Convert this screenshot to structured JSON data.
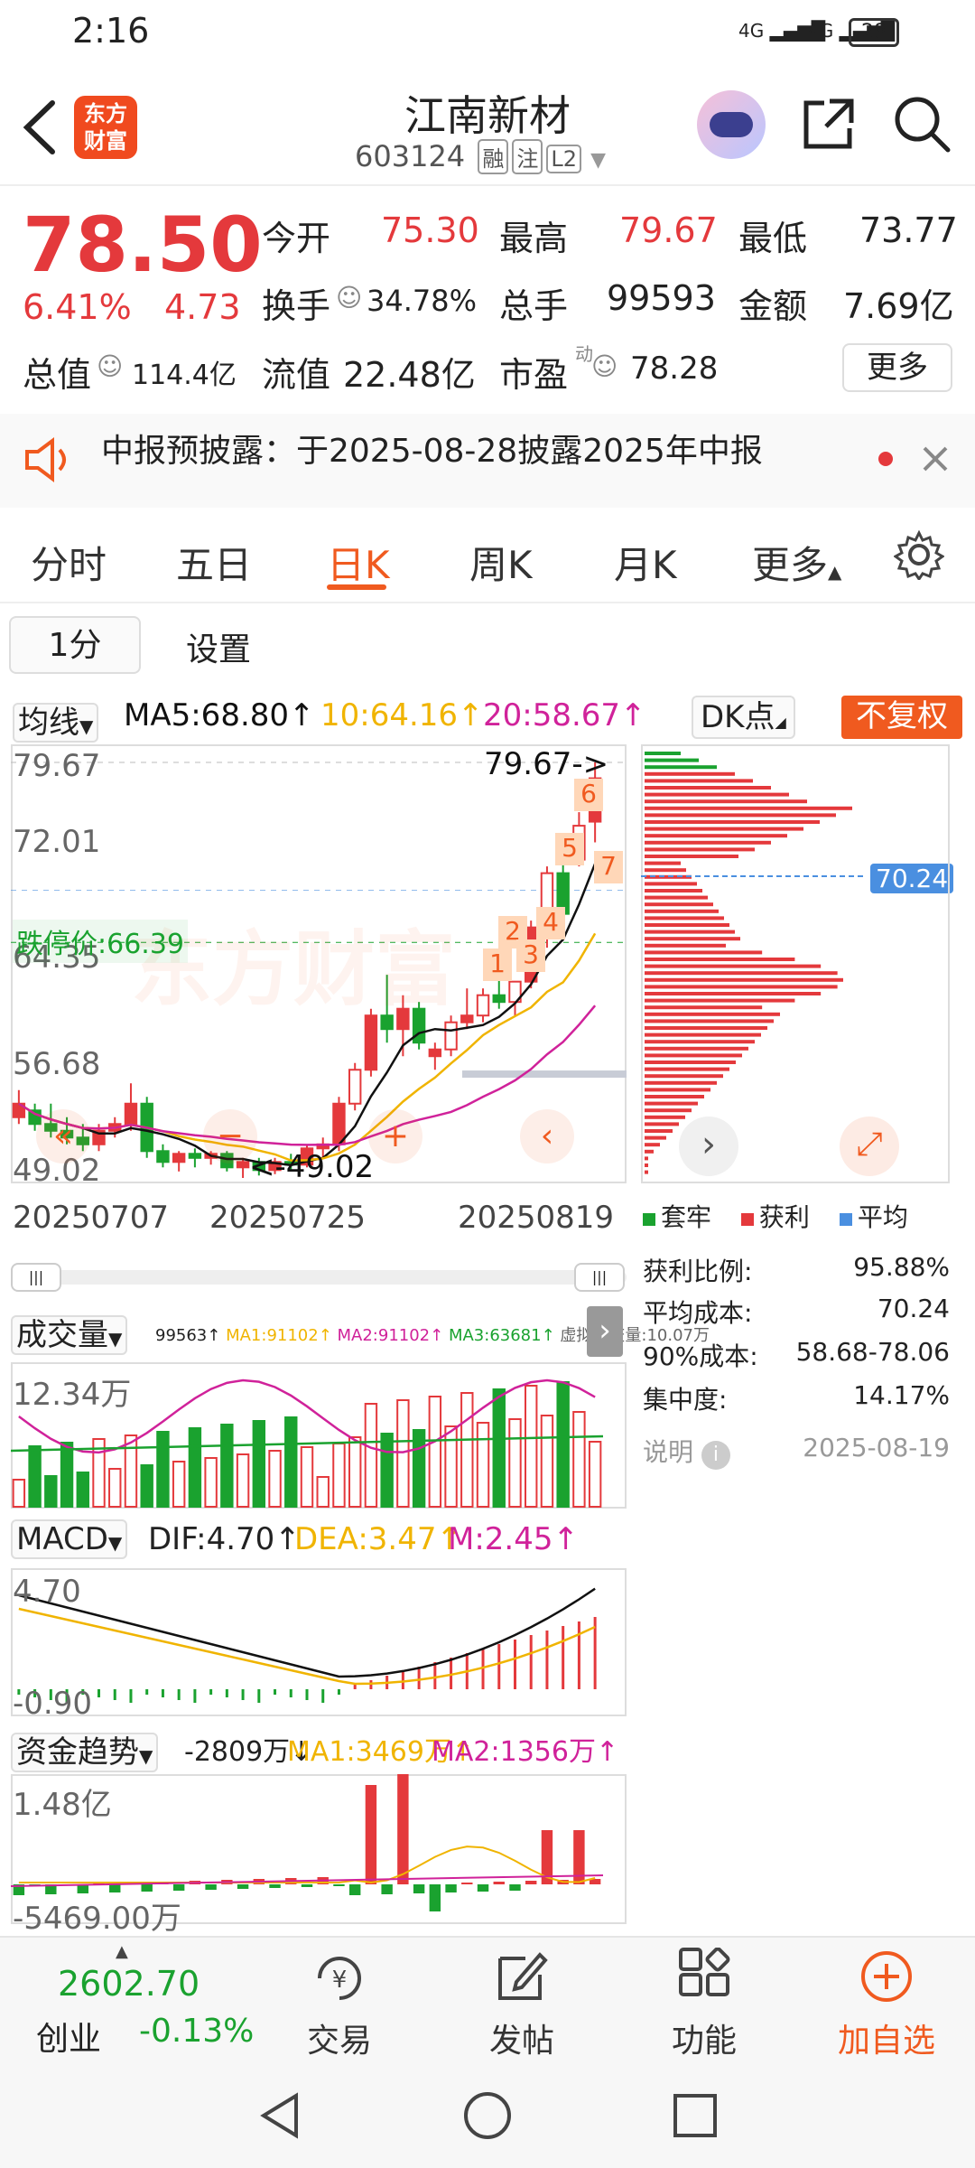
{
  "status": {
    "time": "2:16",
    "battery": "28",
    "net1": "4G",
    "net2": "4G"
  },
  "header": {
    "title": "江南新材",
    "code": "603124",
    "tags": [
      "融",
      "注",
      "L2"
    ],
    "logo_line1": "东方",
    "logo_line2": "财富"
  },
  "quote": {
    "price": "78.50",
    "change_pct": "6.41%",
    "change": "4.73",
    "open_label": "今开",
    "open": "75.30",
    "high_label": "最高",
    "high": "79.67",
    "low_label": "最低",
    "low": "73.77",
    "turnover_label": "换手",
    "turnover": "34.78%",
    "volume_label": "总手",
    "volume": "99593",
    "amount_label": "金额",
    "amount": "7.69亿",
    "mcap_label": "总值",
    "mcap": "114.4亿",
    "float_label": "流值",
    "float": "22.48亿",
    "pe_label": "市盈",
    "pe_sup": "动",
    "pe": "78.28",
    "more": "更多"
  },
  "notice": {
    "text": "中报预披露：于2025-08-28披露2025年中报"
  },
  "tabs": [
    {
      "label": "分时"
    },
    {
      "label": "五日"
    },
    {
      "label": "日K"
    },
    {
      "label": "周K"
    },
    {
      "label": "月K"
    },
    {
      "label": "更多"
    }
  ],
  "controls": {
    "period": "1分",
    "settings": "设置",
    "fq": "不复权",
    "dk": "DK点"
  },
  "ma": {
    "sel": "均线",
    "ma5": "MA5:68.80↑",
    "ma10": "10:64.16↑",
    "ma20": "20:58.67↑"
  },
  "kline": {
    "y_ticks": [
      "79.67",
      "72.01",
      "64.35",
      "56.68",
      "49.02"
    ],
    "x_ticks": [
      "20250707",
      "20250725",
      "20250819"
    ],
    "max_label": "79.67->",
    "min_label": "<-49.02",
    "limit_down": "跌停价:66.39",
    "markers": [
      "1",
      "2",
      "3",
      "4",
      "5",
      "6",
      "7"
    ],
    "avg_cost_label": "70.24",
    "watermark": "东方财富"
  },
  "chart_data": {
    "type": "candlestick",
    "x": [
      "20250707",
      "20250725",
      "20250819"
    ],
    "ohlc": [
      [
        53.5,
        55.5,
        53.0,
        54.5
      ],
      [
        54.0,
        54.5,
        52.5,
        53.0
      ],
      [
        53.0,
        54.5,
        52.0,
        52.5
      ],
      [
        52.5,
        53.5,
        51.5,
        52.0
      ],
      [
        52.0,
        53.0,
        51.0,
        51.5
      ],
      [
        51.5,
        53.0,
        51.0,
        52.5
      ],
      [
        52.5,
        53.5,
        52.0,
        53.0
      ],
      [
        53.0,
        56.0,
        52.5,
        54.5
      ],
      [
        54.5,
        55.0,
        50.5,
        51.0
      ],
      [
        51.0,
        51.5,
        49.8,
        50.2
      ],
      [
        50.2,
        51.0,
        49.5,
        50.8
      ],
      [
        50.8,
        51.2,
        49.8,
        50.5
      ],
      [
        50.5,
        51.0,
        50.0,
        50.8
      ],
      [
        50.8,
        51.0,
        49.5,
        49.8
      ],
      [
        49.8,
        50.5,
        49.02,
        50.2
      ],
      [
        50.2,
        50.5,
        49.2,
        49.6
      ],
      [
        49.6,
        50.5,
        49.3,
        50.2
      ],
      [
        50.2,
        50.8,
        49.5,
        50.0
      ],
      [
        50.0,
        51.5,
        49.8,
        51.2
      ],
      [
        51.2,
        52.0,
        50.5,
        51.5
      ],
      [
        51.5,
        55.0,
        51.0,
        54.5
      ],
      [
        54.5,
        57.5,
        54.0,
        57.0
      ],
      [
        57.0,
        61.5,
        56.5,
        61.0
      ],
      [
        61.0,
        64.0,
        59.0,
        60.0
      ],
      [
        60.0,
        62.5,
        58.0,
        61.5
      ],
      [
        61.5,
        62.0,
        58.5,
        59.0
      ],
      [
        58.0,
        59.0,
        57.0,
        58.5
      ],
      [
        58.5,
        61.0,
        58.0,
        60.5
      ],
      [
        60.5,
        63.0,
        60.0,
        61.0
      ],
      [
        61.0,
        63.0,
        60.5,
        62.5
      ],
      [
        62.5,
        64.5,
        61.5,
        62.0
      ],
      [
        62.0,
        63.5,
        61.0,
        63.5
      ],
      [
        63.5,
        68.0,
        63.0,
        67.5
      ],
      [
        67.5,
        72.0,
        66.0,
        71.5
      ],
      [
        71.5,
        73.0,
        68.0,
        68.5
      ],
      [
        72.5,
        76.0,
        72.0,
        75.0
      ],
      [
        75.3,
        79.67,
        73.77,
        78.5
      ]
    ],
    "ma5_last": 68.8,
    "ma10_last": 64.16,
    "ma20_last": 58.67,
    "volume": {
      "label": "成交量",
      "values": [
        "99563↑",
        "MA1:91102↑",
        "MA2:91102↑",
        "MA3:63681↑",
        "虚拟成交量:10.07万"
      ],
      "max_label": "12.34万"
    },
    "macd": {
      "label": "MACD",
      "dif": "DIF:4.70↑",
      "dea": "DEA:3.47↑",
      "m": "M:2.45↑",
      "ymax": "4.70",
      "ymin": "-0.90"
    },
    "fund": {
      "label": "资金趋势",
      "v": "-2809万↓",
      "ma1": "MA1:3469万↑",
      "ma2": "MA2:1356万↑",
      "ymax": "1.48亿",
      "ymin": "-5469.00万"
    }
  },
  "chip": {
    "legend": [
      "套牢",
      "获利",
      "平均"
    ],
    "rows": [
      {
        "k": "获利比例:",
        "v": "95.88%"
      },
      {
        "k": "平均成本:",
        "v": "70.24"
      },
      {
        "k": "90%成本:",
        "v": "58.68-78.06"
      },
      {
        "k": "集中度:",
        "v": "14.17%"
      }
    ],
    "note": "说明",
    "date": "2025-08-19"
  },
  "bottom": {
    "index_value": "2602.70",
    "index_name": "创业",
    "index_change": "-0.13%",
    "items": [
      {
        "label": "交易"
      },
      {
        "label": "发帖"
      },
      {
        "label": "功能"
      },
      {
        "label": "加自选"
      }
    ]
  },
  "colors": {
    "up": "#e4393c",
    "down": "#1aa22f",
    "accent": "#f05a1f",
    "ma5": "#111111",
    "ma10": "#f0b400",
    "ma20": "#d0229a"
  }
}
